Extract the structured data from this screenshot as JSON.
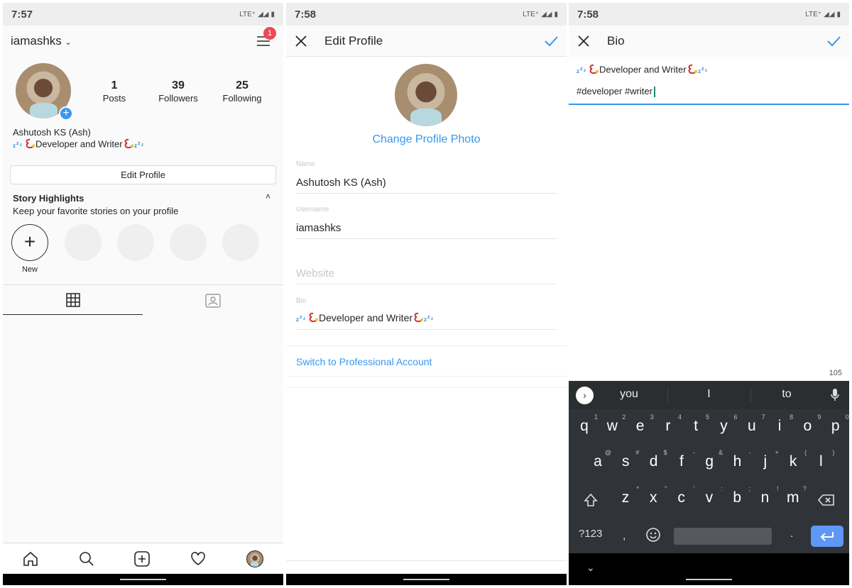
{
  "profile": {
    "time": "7:57",
    "network": "LTE⁺",
    "username": "iamashks",
    "notification_count": "1",
    "stats": [
      {
        "value": "1",
        "label": "Posts"
      },
      {
        "value": "39",
        "label": "Followers"
      },
      {
        "value": "25",
        "label": "Following"
      }
    ],
    "full_name": "Ashutosh KS (Ash)",
    "bio": "Developer and Writer",
    "edit_profile": "Edit Profile",
    "highlights_title": "Story Highlights",
    "highlights_sub": "Keep your favorite stories on your profile",
    "new_label": "New",
    "bottom_nav": [
      "home-icon",
      "search-icon",
      "add-post-icon",
      "heart-icon",
      "profile-avatar"
    ]
  },
  "edit": {
    "time": "7:58",
    "network": "LTE⁺",
    "title": "Edit Profile",
    "change_photo": "Change Profile Photo",
    "fields": [
      {
        "label": "Name",
        "value": "Ashutosh KS (Ash)"
      },
      {
        "label": "Username",
        "value": "iamashks"
      },
      {
        "label": "",
        "placeholder": "Website",
        "value": ""
      },
      {
        "label": "Bio",
        "value": "Developer and Writer"
      }
    ],
    "switch_pro": "Switch to Professional Account",
    "accent": "#3897f0"
  },
  "bio": {
    "time": "7:58",
    "network": "LTE⁺",
    "title": "Bio",
    "line1": "Developer and Writer",
    "line2": "#developer #writer",
    "char_count": "105",
    "keyboard": {
      "suggestions": [
        "you",
        "I",
        "to"
      ],
      "row1": [
        [
          "q",
          "1"
        ],
        [
          "w",
          "2"
        ],
        [
          "e",
          "3"
        ],
        [
          "r",
          "4"
        ],
        [
          "t",
          "5"
        ],
        [
          "y",
          "6"
        ],
        [
          "u",
          "7"
        ],
        [
          "i",
          "8"
        ],
        [
          "o",
          "9"
        ],
        [
          "p",
          "0"
        ]
      ],
      "row2": [
        [
          "a",
          "@"
        ],
        [
          "s",
          "#"
        ],
        [
          "d",
          "$"
        ],
        [
          "f",
          "-"
        ],
        [
          "g",
          "&"
        ],
        [
          "h",
          "-"
        ],
        [
          "j",
          "+"
        ],
        [
          "k",
          "("
        ],
        [
          "l",
          ")"
        ]
      ],
      "row3": [
        [
          "z",
          "*"
        ],
        [
          "x",
          "\""
        ],
        [
          "c",
          "'"
        ],
        [
          "v",
          ":"
        ],
        [
          "b",
          ";"
        ],
        [
          "n",
          "!"
        ],
        [
          "m",
          "?"
        ]
      ],
      "symbols": "?123",
      "comma": ",",
      "period": "."
    }
  }
}
